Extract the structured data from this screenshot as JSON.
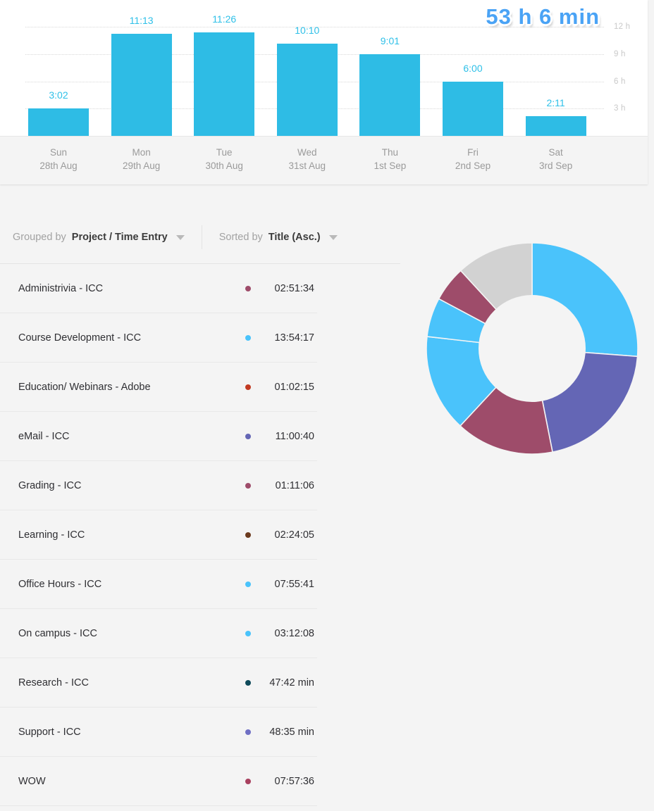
{
  "chart_data": [
    {
      "type": "bar",
      "title": "Weekly time tracked",
      "total_label": "53 h 6 min",
      "categories": [
        "Sun",
        "Mon",
        "Tue",
        "Wed",
        "Thu",
        "Fri",
        "Sat"
      ],
      "dates": [
        "28th Aug",
        "29th Aug",
        "30th Aug",
        "31st Aug",
        "1st Sep",
        "2nd Sep",
        "3rd Sep"
      ],
      "value_labels": [
        "3:02",
        "11:13",
        "11:26",
        "10:10",
        "9:01",
        "6:00",
        "2:11"
      ],
      "values": [
        3.03,
        11.22,
        11.43,
        10.17,
        9.02,
        6.0,
        2.18
      ],
      "ylabel": "",
      "xlabel": "",
      "ylim": [
        0,
        13
      ],
      "yticks": [
        3,
        6,
        9,
        12
      ],
      "ytick_labels": [
        "3 h",
        "6 h",
        "9 h",
        "12 h"
      ],
      "grid": true,
      "legend": "none",
      "bar_color": "#2ebce5",
      "value_label_color": "#2fc0e8"
    },
    {
      "type": "pie",
      "variant": "donut",
      "title": "",
      "legend": "none",
      "labels": [
        "Course Development - ICC",
        "eMail - ICC",
        "WOW",
        "Office Hours - ICC",
        "On campus - ICC",
        "Administrivia - ICC",
        "Other"
      ],
      "values": [
        26.2,
        20.7,
        15.0,
        14.9,
        6.0,
        5.4,
        11.8
      ],
      "colors": [
        "#4ac3fb",
        "#6466b5",
        "#9e4c6a",
        "#4ac3fb",
        "#4ac3fb",
        "#9e4c6a",
        "#d2d2d2"
      ]
    }
  ],
  "chart": {
    "total": "53 h 6 min",
    "yticks": [
      "12 h",
      "9 h",
      "6 h",
      "3 h"
    ],
    "bars": [
      {
        "day": "Sun",
        "date": "28th Aug",
        "label": "3:02",
        "hours": 3.03
      },
      {
        "day": "Mon",
        "date": "29th Aug",
        "label": "11:13",
        "hours": 11.22
      },
      {
        "day": "Tue",
        "date": "30th Aug",
        "label": "11:26",
        "hours": 11.43
      },
      {
        "day": "Wed",
        "date": "31st Aug",
        "label": "10:10",
        "hours": 10.17
      },
      {
        "day": "Thu",
        "date": "1st Sep",
        "label": "9:01",
        "hours": 9.02
      },
      {
        "day": "Fri",
        "date": "2nd Sep",
        "label": "6:00",
        "hours": 6.0
      },
      {
        "day": "Sat",
        "date": "3rd Sep",
        "label": "2:11",
        "hours": 2.18
      }
    ]
  },
  "controls": {
    "grouped": {
      "label": "Grouped by",
      "value": "Project / Time Entry"
    },
    "sorted": {
      "label": "Sorted by",
      "value": "Title (Asc.)"
    }
  },
  "list": {
    "rows": [
      {
        "title": "Administrivia - ICC",
        "duration": "02:51:34",
        "color": "#9e4c6a"
      },
      {
        "title": "Course Development - ICC",
        "duration": "13:54:17",
        "color": "#4ac3fb"
      },
      {
        "title": "Education/ Webinars - Adobe",
        "duration": "01:02:15",
        "color": "#c23a22"
      },
      {
        "title": "eMail - ICC",
        "duration": "11:00:40",
        "color": "#6466b5"
      },
      {
        "title": "Grading - ICC",
        "duration": "01:11:06",
        "color": "#9e4c6a"
      },
      {
        "title": "Learning - ICC",
        "duration": "02:24:05",
        "color": "#6b3a1e"
      },
      {
        "title": "Office Hours - ICC",
        "duration": "07:55:41",
        "color": "#4ac3fb"
      },
      {
        "title": "On campus - ICC",
        "duration": "03:12:08",
        "color": "#4ac3fb"
      },
      {
        "title": "Research - ICC",
        "duration": "47:42 min",
        "color": "#0f4a5a"
      },
      {
        "title": "Support - ICC",
        "duration": "48:35 min",
        "color": "#6f6fc4"
      },
      {
        "title": "WOW",
        "duration": "07:57:36",
        "color": "#a8415f"
      }
    ]
  }
}
